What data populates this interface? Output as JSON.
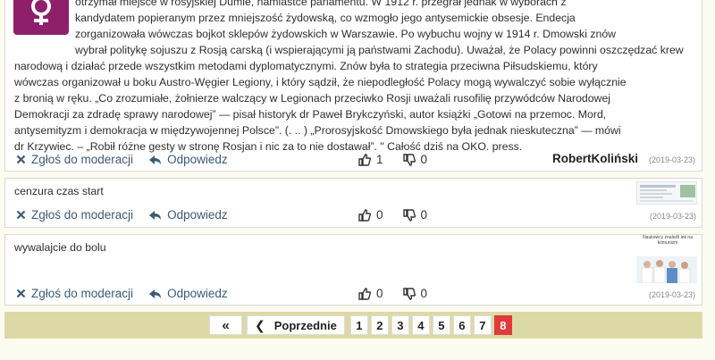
{
  "comments": [
    {
      "text_lines": [
        "otrzymał miejsce w rosyjskiej Dumie, namiastce parlamentu. W 1912 r. przegrał jednak w wyborach z",
        "kandydatem popieranym przez mniejszość żydowską, co wzmogło jego antysemickie obsesje. Endecja",
        "zorganizowała wówczas bojkot sklepów żydowskich w Warszawie. Po wybuchu wojny w 1914 r. Dmowski znów",
        "wybrał politykę sojuszu z Rosją carską (i wspierającymi ją państwami Zachodu). Uważał, że Polacy powinni oszczędzać krew"
      ],
      "text_cont_lines": [
        "narodową i działać przede wszystkim metodami dyplomatycznymi. Znów była to strategia przeciwna Piłsudskiemu, który",
        "wówczas organizował u boku Austro-Węgier Legiony, i który sądził, że niepodległość Polacy mogą wywalczyć sobie wyłącznie",
        "z bronią w ręku. „Co zrozumiałe, żołnierze walczący w Legionach przeciwko Rosji uważali rusofilię przywódców Narodowej",
        "Demokracji za zdradę sprawy narodowej” — pisał historyk dr Paweł Brykczyński, autor książki „Gotowi na przemoc. Mord,",
        "antysemityzm i demokracja w międzywojennej Polsce”. (. .. ) „Prorosyjskość Dmowskiego była jednak nieskuteczna” — mówi",
        "dr Krzywiec. – „Robił różne gesty w stronę Rosjan i nic za to nie dostawał”. \" Całość dziś na OKO. press."
      ],
      "report_label": "Zgłoś do moderacji",
      "reply_label": "Odpowiedz",
      "likes": "1",
      "dislikes": "0",
      "author": "RobertKoliński",
      "date": "(2019-03-23)"
    },
    {
      "text": "cenzura czas start",
      "report_label": "Zgłoś do moderacji",
      "reply_label": "Odpowiedz",
      "likes": "0",
      "dislikes": "0",
      "date": "(2019-03-23)"
    },
    {
      "text": "wywalajcie do bolu",
      "thumb_caption": "Naukowcy znaleźli lek na komunizm",
      "report_label": "Zgłoś do moderacji",
      "reply_label": "Odpowiedz",
      "likes": "0",
      "dislikes": "0",
      "date": "(2019-03-23)"
    }
  ],
  "pagination": {
    "first_label": "«",
    "prev_label": "Poprzednie",
    "pages": [
      "1",
      "2",
      "3",
      "4",
      "5",
      "6",
      "7",
      "8"
    ],
    "current_page": "8"
  },
  "colors": {
    "action_blue": "#3d5a75",
    "avatar_purple": "#8e1f6a",
    "pager_bar": "#ddd9a6",
    "active_page": "#e03a3a"
  }
}
